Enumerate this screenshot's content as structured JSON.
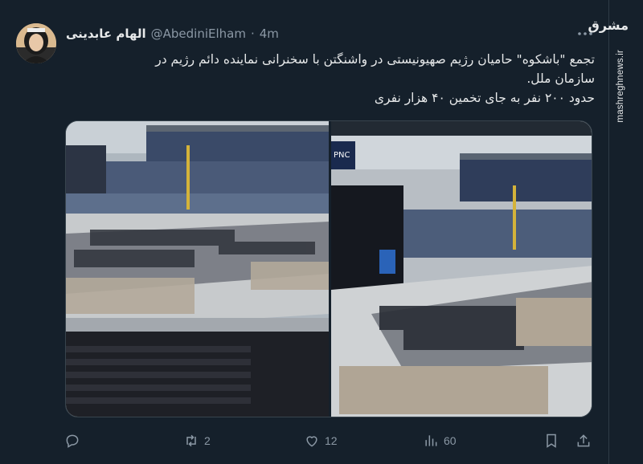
{
  "author": {
    "display_name": "الهام عابدینی",
    "handle": "@AbediniElham",
    "separator": "·",
    "time": "4m"
  },
  "tweet": {
    "lines": [
      "تجمع \"باشکوه\" حامیان رژیم صهیونیستی در واشنگتن با سخنرانی نماینده دائم رژیم در",
      "سازمان ملل.",
      "حدود ۲۰۰ نفر به جای تخمین ۴۰ هزار نفری"
    ]
  },
  "media": {
    "left_image": "stadium-photo-empty-seats-left",
    "right_image": "stadium-photo-empty-seats-right",
    "stadium_signs": [
      "PNC"
    ]
  },
  "actions": {
    "reply": {
      "icon": "reply-icon",
      "count": ""
    },
    "retweet": {
      "icon": "retweet-icon",
      "count": "2"
    },
    "like": {
      "icon": "heart-icon",
      "count": "12"
    },
    "views": {
      "icon": "views-icon",
      "count": "60"
    },
    "bookmark": {
      "icon": "bookmark-icon"
    },
    "share": {
      "icon": "share-icon"
    }
  },
  "watermark": {
    "logo": "مشرق",
    "site": "mashreghnews.ir"
  },
  "colors": {
    "background": "#15202b",
    "text": "#e7e9ea",
    "secondary": "#8b98a5"
  }
}
